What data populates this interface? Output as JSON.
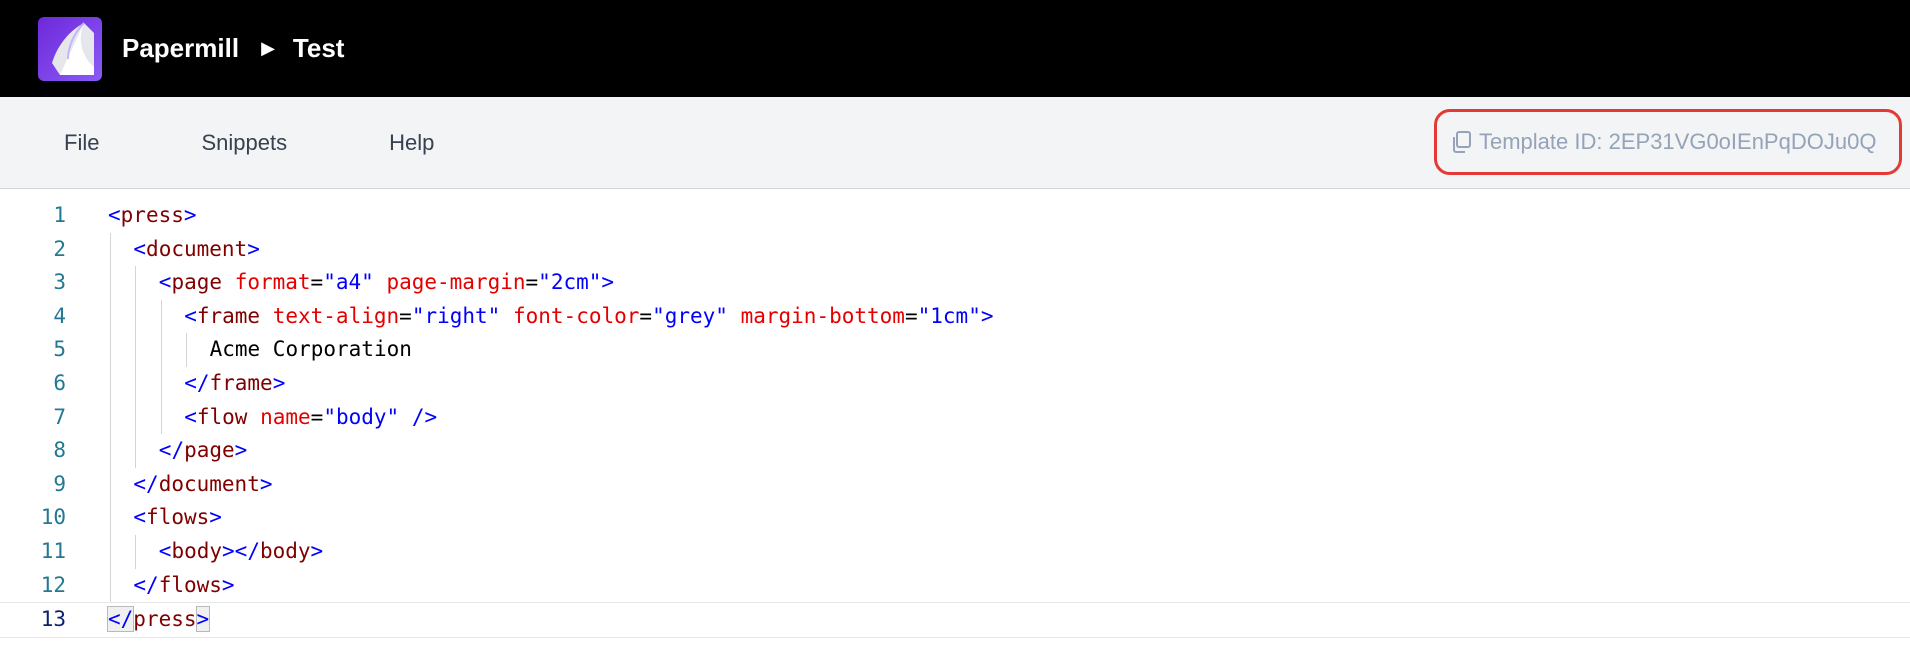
{
  "header": {
    "app_name": "Papermill",
    "breadcrumb_current": "Test",
    "logo_icon": "papermill-logo-icon",
    "separator_icon": "caret-right-icon"
  },
  "menu": {
    "file": "File",
    "snippets": "Snippets",
    "help": "Help"
  },
  "template": {
    "label": "Template ID: 2EP31VG0oIEnPqDOJu0Q",
    "icon": "copy-icon",
    "highlight_color": "#e53935"
  },
  "editor": {
    "active_line": 13,
    "line_numbers": [
      "1",
      "2",
      "3",
      "4",
      "5",
      "6",
      "7",
      "8",
      "9",
      "10",
      "11",
      "12",
      "13"
    ],
    "colors": {
      "tag": "#800000",
      "punct": "#0000ff",
      "attr": "#e50000",
      "string": "#0000ff",
      "text": "#000000",
      "line_number": "#237893"
    },
    "lines": [
      [
        {
          "k": "p",
          "v": "<"
        },
        {
          "k": "t",
          "v": "press"
        },
        {
          "k": "p",
          "v": ">"
        }
      ],
      [
        {
          "k": "p",
          "v": "<"
        },
        {
          "k": "t",
          "v": "document"
        },
        {
          "k": "p",
          "v": ">"
        }
      ],
      [
        {
          "k": "p",
          "v": "<"
        },
        {
          "k": "t",
          "v": "page"
        },
        {
          "k": "x",
          "v": " "
        },
        {
          "k": "a",
          "v": "format"
        },
        {
          "k": "x",
          "v": "="
        },
        {
          "k": "s",
          "v": "\"a4\""
        },
        {
          "k": "x",
          "v": " "
        },
        {
          "k": "a",
          "v": "page-margin"
        },
        {
          "k": "x",
          "v": "="
        },
        {
          "k": "s",
          "v": "\"2cm\""
        },
        {
          "k": "p",
          "v": ">"
        }
      ],
      [
        {
          "k": "p",
          "v": "<"
        },
        {
          "k": "t",
          "v": "frame"
        },
        {
          "k": "x",
          "v": " "
        },
        {
          "k": "a",
          "v": "text-align"
        },
        {
          "k": "x",
          "v": "="
        },
        {
          "k": "s",
          "v": "\"right\""
        },
        {
          "k": "x",
          "v": " "
        },
        {
          "k": "a",
          "v": "font-color"
        },
        {
          "k": "x",
          "v": "="
        },
        {
          "k": "s",
          "v": "\"grey\""
        },
        {
          "k": "x",
          "v": " "
        },
        {
          "k": "a",
          "v": "margin-bottom"
        },
        {
          "k": "x",
          "v": "="
        },
        {
          "k": "s",
          "v": "\"1cm\""
        },
        {
          "k": "p",
          "v": ">"
        }
      ],
      [
        {
          "k": "x",
          "v": "Acme Corporation"
        }
      ],
      [
        {
          "k": "p",
          "v": "</"
        },
        {
          "k": "t",
          "v": "frame"
        },
        {
          "k": "p",
          "v": ">"
        }
      ],
      [
        {
          "k": "p",
          "v": "<"
        },
        {
          "k": "t",
          "v": "flow"
        },
        {
          "k": "x",
          "v": " "
        },
        {
          "k": "a",
          "v": "name"
        },
        {
          "k": "x",
          "v": "="
        },
        {
          "k": "s",
          "v": "\"body\""
        },
        {
          "k": "x",
          "v": " "
        },
        {
          "k": "p",
          "v": "/>"
        }
      ],
      [
        {
          "k": "p",
          "v": "</"
        },
        {
          "k": "t",
          "v": "page"
        },
        {
          "k": "p",
          "v": ">"
        }
      ],
      [
        {
          "k": "p",
          "v": "</"
        },
        {
          "k": "t",
          "v": "document"
        },
        {
          "k": "p",
          "v": ">"
        }
      ],
      [
        {
          "k": "p",
          "v": "<"
        },
        {
          "k": "t",
          "v": "flows"
        },
        {
          "k": "p",
          "v": ">"
        }
      ],
      [
        {
          "k": "p",
          "v": "<"
        },
        {
          "k": "t",
          "v": "body"
        },
        {
          "k": "p",
          "v": "></"
        },
        {
          "k": "t",
          "v": "body"
        },
        {
          "k": "p",
          "v": ">"
        }
      ],
      [
        {
          "k": "p",
          "v": "</"
        },
        {
          "k": "t",
          "v": "flows"
        },
        {
          "k": "p",
          "v": ">"
        }
      ],
      [
        {
          "k": "p",
          "v": "</"
        },
        {
          "k": "t",
          "v": "press"
        },
        {
          "k": "p",
          "v": ">"
        }
      ]
    ]
  }
}
